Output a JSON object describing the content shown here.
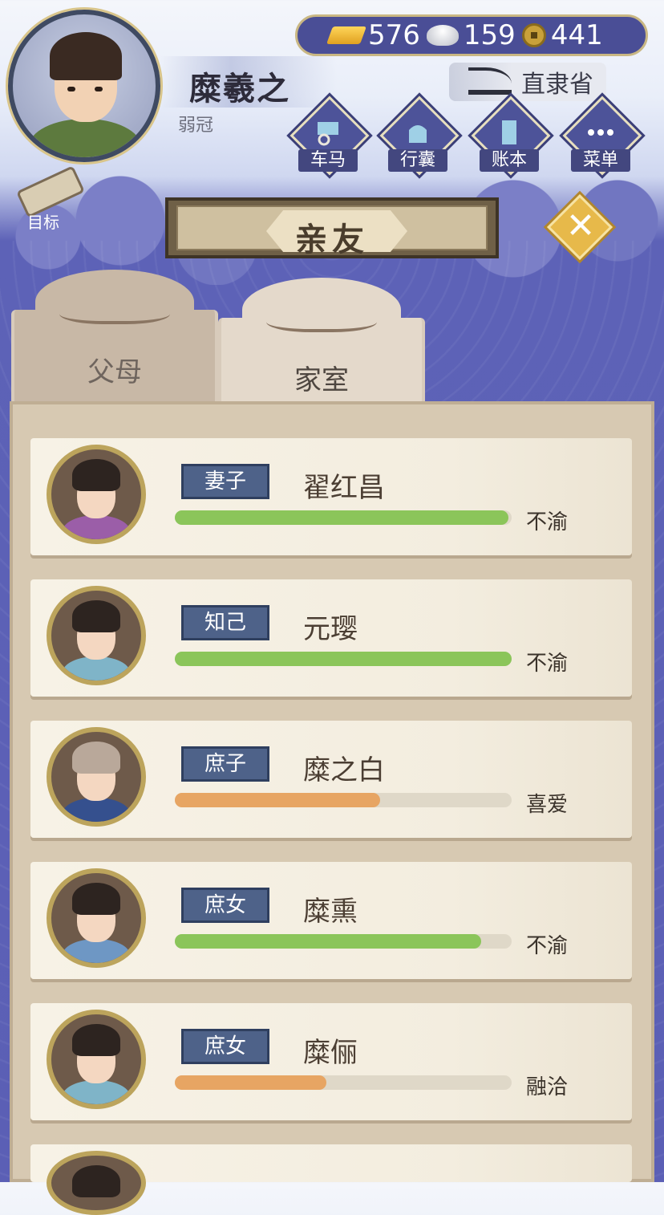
{
  "player": {
    "name": "糜羲之",
    "title": "弱冠"
  },
  "resources": [
    {
      "icon": "gold-ingot-icon",
      "value": "576"
    },
    {
      "icon": "silver-ingot-icon",
      "value": "159"
    },
    {
      "icon": "copper-coin-icon",
      "value": "441"
    }
  ],
  "location": "直隶省",
  "top_buttons": [
    {
      "id": "carriage",
      "label": "车马",
      "icon": "carriage-icon"
    },
    {
      "id": "bag",
      "label": "行囊",
      "icon": "bag-icon"
    },
    {
      "id": "ledger",
      "label": "账本",
      "icon": "ledger-icon"
    },
    {
      "id": "menu",
      "label": "菜单",
      "icon": "more-dots-icon"
    }
  ],
  "goal_label": "目标",
  "page_title": "亲友",
  "tabs": [
    {
      "label": "父母",
      "active": false
    },
    {
      "label": "家室",
      "active": true
    }
  ],
  "relatives": [
    {
      "relation": "妻子",
      "name": "翟红昌",
      "mood": "不渝",
      "affection": 0.99,
      "bar_color": "#8bc55a"
    },
    {
      "relation": "知己",
      "name": "元璎",
      "mood": "不渝",
      "affection": 1.0,
      "bar_color": "#8bc55a"
    },
    {
      "relation": "庶子",
      "name": "糜之白",
      "mood": "喜爱",
      "affection": 0.61,
      "bar_color": "#e7a563"
    },
    {
      "relation": "庶女",
      "name": "糜熏",
      "mood": "不渝",
      "affection": 0.91,
      "bar_color": "#8bc55a"
    },
    {
      "relation": "庶女",
      "name": "糜俪",
      "mood": "融洽",
      "affection": 0.45,
      "bar_color": "#e7a563"
    }
  ],
  "colors": {
    "panel": "#d7c9b2",
    "accent_blue": "#4e6289",
    "gold": "#e7b94a"
  }
}
